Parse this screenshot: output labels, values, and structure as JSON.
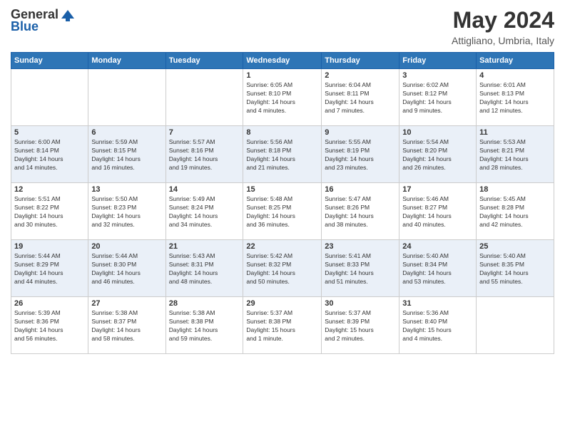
{
  "header": {
    "logo_general": "General",
    "logo_blue": "Blue",
    "month_year": "May 2024",
    "location": "Attigliano, Umbria, Italy"
  },
  "calendar": {
    "headers": [
      "Sunday",
      "Monday",
      "Tuesday",
      "Wednesday",
      "Thursday",
      "Friday",
      "Saturday"
    ],
    "weeks": [
      {
        "days": [
          {
            "num": "",
            "info": ""
          },
          {
            "num": "",
            "info": ""
          },
          {
            "num": "",
            "info": ""
          },
          {
            "num": "1",
            "info": "Sunrise: 6:05 AM\nSunset: 8:10 PM\nDaylight: 14 hours\nand 4 minutes."
          },
          {
            "num": "2",
            "info": "Sunrise: 6:04 AM\nSunset: 8:11 PM\nDaylight: 14 hours\nand 7 minutes."
          },
          {
            "num": "3",
            "info": "Sunrise: 6:02 AM\nSunset: 8:12 PM\nDaylight: 14 hours\nand 9 minutes."
          },
          {
            "num": "4",
            "info": "Sunrise: 6:01 AM\nSunset: 8:13 PM\nDaylight: 14 hours\nand 12 minutes."
          }
        ]
      },
      {
        "days": [
          {
            "num": "5",
            "info": "Sunrise: 6:00 AM\nSunset: 8:14 PM\nDaylight: 14 hours\nand 14 minutes."
          },
          {
            "num": "6",
            "info": "Sunrise: 5:59 AM\nSunset: 8:15 PM\nDaylight: 14 hours\nand 16 minutes."
          },
          {
            "num": "7",
            "info": "Sunrise: 5:57 AM\nSunset: 8:16 PM\nDaylight: 14 hours\nand 19 minutes."
          },
          {
            "num": "8",
            "info": "Sunrise: 5:56 AM\nSunset: 8:18 PM\nDaylight: 14 hours\nand 21 minutes."
          },
          {
            "num": "9",
            "info": "Sunrise: 5:55 AM\nSunset: 8:19 PM\nDaylight: 14 hours\nand 23 minutes."
          },
          {
            "num": "10",
            "info": "Sunrise: 5:54 AM\nSunset: 8:20 PM\nDaylight: 14 hours\nand 26 minutes."
          },
          {
            "num": "11",
            "info": "Sunrise: 5:53 AM\nSunset: 8:21 PM\nDaylight: 14 hours\nand 28 minutes."
          }
        ]
      },
      {
        "days": [
          {
            "num": "12",
            "info": "Sunrise: 5:51 AM\nSunset: 8:22 PM\nDaylight: 14 hours\nand 30 minutes."
          },
          {
            "num": "13",
            "info": "Sunrise: 5:50 AM\nSunset: 8:23 PM\nDaylight: 14 hours\nand 32 minutes."
          },
          {
            "num": "14",
            "info": "Sunrise: 5:49 AM\nSunset: 8:24 PM\nDaylight: 14 hours\nand 34 minutes."
          },
          {
            "num": "15",
            "info": "Sunrise: 5:48 AM\nSunset: 8:25 PM\nDaylight: 14 hours\nand 36 minutes."
          },
          {
            "num": "16",
            "info": "Sunrise: 5:47 AM\nSunset: 8:26 PM\nDaylight: 14 hours\nand 38 minutes."
          },
          {
            "num": "17",
            "info": "Sunrise: 5:46 AM\nSunset: 8:27 PM\nDaylight: 14 hours\nand 40 minutes."
          },
          {
            "num": "18",
            "info": "Sunrise: 5:45 AM\nSunset: 8:28 PM\nDaylight: 14 hours\nand 42 minutes."
          }
        ]
      },
      {
        "days": [
          {
            "num": "19",
            "info": "Sunrise: 5:44 AM\nSunset: 8:29 PM\nDaylight: 14 hours\nand 44 minutes."
          },
          {
            "num": "20",
            "info": "Sunrise: 5:44 AM\nSunset: 8:30 PM\nDaylight: 14 hours\nand 46 minutes."
          },
          {
            "num": "21",
            "info": "Sunrise: 5:43 AM\nSunset: 8:31 PM\nDaylight: 14 hours\nand 48 minutes."
          },
          {
            "num": "22",
            "info": "Sunrise: 5:42 AM\nSunset: 8:32 PM\nDaylight: 14 hours\nand 50 minutes."
          },
          {
            "num": "23",
            "info": "Sunrise: 5:41 AM\nSunset: 8:33 PM\nDaylight: 14 hours\nand 51 minutes."
          },
          {
            "num": "24",
            "info": "Sunrise: 5:40 AM\nSunset: 8:34 PM\nDaylight: 14 hours\nand 53 minutes."
          },
          {
            "num": "25",
            "info": "Sunrise: 5:40 AM\nSunset: 8:35 PM\nDaylight: 14 hours\nand 55 minutes."
          }
        ]
      },
      {
        "days": [
          {
            "num": "26",
            "info": "Sunrise: 5:39 AM\nSunset: 8:36 PM\nDaylight: 14 hours\nand 56 minutes."
          },
          {
            "num": "27",
            "info": "Sunrise: 5:38 AM\nSunset: 8:37 PM\nDaylight: 14 hours\nand 58 minutes."
          },
          {
            "num": "28",
            "info": "Sunrise: 5:38 AM\nSunset: 8:38 PM\nDaylight: 14 hours\nand 59 minutes."
          },
          {
            "num": "29",
            "info": "Sunrise: 5:37 AM\nSunset: 8:38 PM\nDaylight: 15 hours\nand 1 minute."
          },
          {
            "num": "30",
            "info": "Sunrise: 5:37 AM\nSunset: 8:39 PM\nDaylight: 15 hours\nand 2 minutes."
          },
          {
            "num": "31",
            "info": "Sunrise: 5:36 AM\nSunset: 8:40 PM\nDaylight: 15 hours\nand 4 minutes."
          },
          {
            "num": "",
            "info": ""
          }
        ]
      }
    ]
  }
}
